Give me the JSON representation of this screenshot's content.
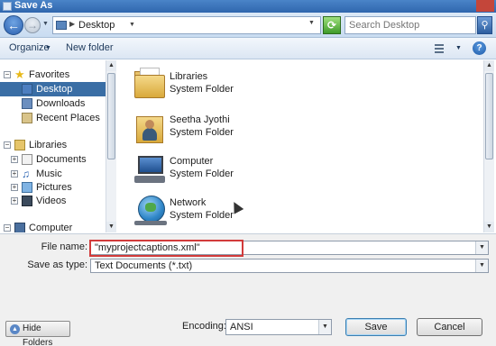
{
  "window": {
    "title": "Save As"
  },
  "address": {
    "crumb": "Desktop"
  },
  "search": {
    "placeholder": "Search Desktop"
  },
  "toolbar": {
    "organize": "Organize",
    "new_folder": "New folder"
  },
  "nav": {
    "items": [
      {
        "label": "Favorites",
        "icon": "star-icon"
      },
      {
        "label": "Desktop",
        "icon": "desktop-icon"
      },
      {
        "label": "Downloads",
        "icon": "downloads-icon"
      },
      {
        "label": "Recent Places",
        "icon": "recent-places-icon"
      },
      {
        "label": "Libraries",
        "icon": "libraries-icon"
      },
      {
        "label": "Documents",
        "icon": "documents-icon"
      },
      {
        "label": "Music",
        "icon": "music-icon"
      },
      {
        "label": "Pictures",
        "icon": "pictures-icon"
      },
      {
        "label": "Videos",
        "icon": "videos-icon"
      },
      {
        "label": "Computer",
        "icon": "computer-icon"
      }
    ]
  },
  "files": [
    {
      "name": "Libraries",
      "type": "System Folder",
      "icon": "libraries-folder-icon"
    },
    {
      "name": "Seetha Jyothi",
      "type": "System Folder",
      "icon": "user-folder-icon"
    },
    {
      "name": "Computer",
      "type": "System Folder",
      "icon": "computer-icon"
    },
    {
      "name": "Network",
      "type": "System Folder",
      "icon": "network-icon"
    }
  ],
  "form": {
    "file_name_label": "File name:",
    "file_name_value": "\"myprojectcaptions.xml\"",
    "save_as_type_label": "Save as type:",
    "save_as_type_value": "Text Documents (*.txt)",
    "encoding_label": "Encoding:",
    "encoding_value": "ANSI"
  },
  "buttons": {
    "hide_folders": "Hide Folders",
    "save": "Save",
    "cancel": "Cancel",
    "help": "?"
  },
  "colors": {
    "selection": "#3a6ea5",
    "highlight_box": "#d23b3b",
    "titlebar": "#3a74bb"
  }
}
